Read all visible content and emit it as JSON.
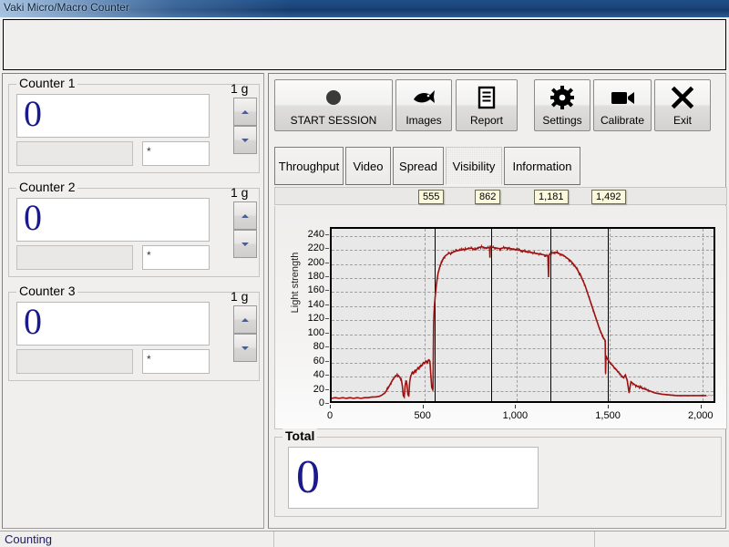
{
  "window": {
    "title": "Vaki Micro/Macro Counter"
  },
  "counters": [
    {
      "legend": "Counter 1",
      "value": "0",
      "grey_field": "",
      "star_field": "*",
      "unit": "1 g"
    },
    {
      "legend": "Counter 2",
      "value": "0",
      "grey_field": "",
      "star_field": "*",
      "unit": "1 g"
    },
    {
      "legend": "Counter 3",
      "value": "0",
      "grey_field": "",
      "star_field": "*",
      "unit": "1 g"
    }
  ],
  "toolbar": [
    {
      "label": "START SESSION",
      "icon": "record-circle-icon"
    },
    {
      "label": "Images",
      "icon": "fish-icon"
    },
    {
      "label": "Report",
      "icon": "document-icon"
    },
    {
      "label": "Settings",
      "icon": "gear-icon"
    },
    {
      "label": "Calibrate",
      "icon": "video-camera-icon"
    },
    {
      "label": "Exit",
      "icon": "close-x-icon"
    }
  ],
  "tabs": [
    {
      "label": "Throughput",
      "active": false
    },
    {
      "label": "Video",
      "active": false
    },
    {
      "label": "Spread",
      "active": false
    },
    {
      "label": "Visibility",
      "active": true
    },
    {
      "label": "Information",
      "active": false
    }
  ],
  "markers": [
    {
      "label": "555"
    },
    {
      "label": "862"
    },
    {
      "label": "1,181"
    },
    {
      "label": "1,492"
    }
  ],
  "total": {
    "legend": "Total",
    "value": "0"
  },
  "statusbar": {
    "text": "Counting"
  },
  "colors": {
    "trace": "#9e1212",
    "value_text": "#1a1a8c",
    "plot_bg": "#e8e8e8",
    "marker_bg": "#fbf8dc",
    "titlebar": "#1b4478"
  },
  "chart_data": {
    "type": "line",
    "title": "",
    "xlabel": "",
    "ylabel": "Light strength",
    "xlim": [
      0,
      2080
    ],
    "ylim": [
      0,
      250
    ],
    "xticks": [
      0,
      500,
      1000,
      1500,
      2000
    ],
    "xtick_labels": [
      "0",
      "500",
      "1,000",
      "1,500",
      "2,000"
    ],
    "yticks": [
      0,
      20,
      40,
      60,
      80,
      100,
      120,
      140,
      160,
      180,
      200,
      220,
      240
    ],
    "ytick_labels": [
      "0",
      "20",
      "40",
      "60",
      "80",
      "100",
      "120",
      "140",
      "160",
      "180",
      "200",
      "220",
      "240"
    ],
    "grid": true,
    "legend": "none",
    "vertical_markers": [
      555,
      862,
      1181,
      1492
    ],
    "series": [
      {
        "name": "Light strength",
        "color": "#9e1212",
        "x": [
          0,
          20,
          40,
          60,
          80,
          100,
          120,
          140,
          160,
          180,
          200,
          220,
          240,
          260,
          275,
          290,
          300,
          310,
          320,
          330,
          340,
          350,
          360,
          370,
          380,
          385,
          390,
          395,
          400,
          405,
          410,
          415,
          420,
          425,
          430,
          435,
          440,
          445,
          450,
          455,
          460,
          465,
          470,
          475,
          480,
          485,
          490,
          495,
          500,
          505,
          510,
          515,
          520,
          525,
          530,
          535,
          540,
          545,
          550,
          552,
          555,
          557,
          560,
          565,
          570,
          575,
          580,
          590,
          600,
          610,
          620,
          630,
          640,
          650,
          660,
          680,
          700,
          720,
          740,
          760,
          780,
          800,
          820,
          840,
          860,
          862,
          864,
          880,
          900,
          920,
          940,
          960,
          980,
          1000,
          1020,
          1040,
          1060,
          1080,
          1100,
          1120,
          1140,
          1160,
          1178,
          1181,
          1184,
          1200,
          1220,
          1240,
          1260,
          1280,
          1300,
          1320,
          1340,
          1360,
          1380,
          1400,
          1420,
          1440,
          1460,
          1480,
          1490,
          1492,
          1494,
          1500,
          1510,
          1520,
          1530,
          1540,
          1550,
          1560,
          1570,
          1580,
          1590,
          1600,
          1610,
          1620,
          1630,
          1640,
          1650,
          1660,
          1680,
          1700,
          1720,
          1740,
          1760,
          1780,
          1800,
          1840,
          1880,
          1920,
          1960,
          2000,
          2040,
          2080
        ],
        "y": [
          4,
          5,
          4,
          5,
          4,
          5,
          4,
          5,
          4,
          5,
          5,
          6,
          6,
          7,
          9,
          12,
          16,
          20,
          25,
          30,
          34,
          37,
          38,
          35,
          30,
          22,
          8,
          6,
          22,
          30,
          24,
          10,
          7,
          28,
          36,
          39,
          42,
          40,
          43,
          45,
          44,
          46,
          48,
          47,
          50,
          52,
          51,
          54,
          56,
          55,
          57,
          58,
          56,
          59,
          60,
          58,
          38,
          20,
          17,
          18,
          110,
          125,
          140,
          155,
          168,
          178,
          186,
          196,
          203,
          208,
          211,
          213,
          215,
          214,
          216,
          218,
          219,
          220,
          221,
          222,
          220,
          223,
          224,
          222,
          223,
          208,
          224,
          223,
          222,
          221,
          223,
          222,
          221,
          220,
          219,
          218,
          217,
          216,
          215,
          214,
          213,
          212,
          210,
          180,
          212,
          215,
          216,
          214,
          212,
          208,
          204,
          198,
          190,
          180,
          168,
          152,
          136,
          120,
          104,
          92,
          88,
          40,
          66,
          62,
          58,
          54,
          52,
          48,
          46,
          42,
          40,
          36,
          34,
          38,
          30,
          12,
          28,
          26,
          24,
          22,
          20,
          18,
          16,
          14,
          12,
          11,
          10,
          9,
          8,
          8,
          8,
          8,
          8
        ]
      }
    ]
  }
}
